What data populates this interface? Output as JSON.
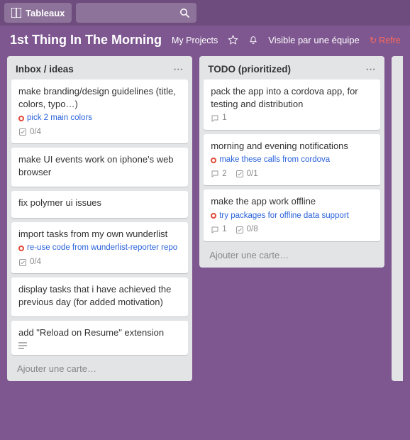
{
  "topbar": {
    "boards_label": "Tableaux"
  },
  "header": {
    "board_title": "1st Thing In The Morning",
    "my_projects": "My Projects",
    "visibility": "Visible par une équipe",
    "refresh": "Refre"
  },
  "lists": [
    {
      "title": "Inbox / ideas",
      "add_card": "Ajouter une carte…",
      "cards": [
        {
          "title": "make branding/design guidelines (title, colors, typo…)",
          "subtask": "pick 2 main colors",
          "checklist": "0/4"
        },
        {
          "title": "make UI events work on iphone's web browser"
        },
        {
          "title": "fix polymer ui issues"
        },
        {
          "title": "import tasks from my own wunderlist",
          "subtask": "re-use code from wunderlist-reporter repo",
          "checklist": "0/4"
        },
        {
          "title": "display tasks that i have achieved the previous day (for added motivation)"
        },
        {
          "title": "add \"Reload on Resume\" extension",
          "has_description": true
        }
      ]
    },
    {
      "title": "TODO (prioritized)",
      "add_card": "Ajouter une carte…",
      "cards": [
        {
          "title": "pack the app into a cordova app, for testing and distribution",
          "comments": "1"
        },
        {
          "title": "morning and evening notifications",
          "subtask": "make these calls from cordova",
          "comments": "2",
          "checklist": "0/1"
        },
        {
          "title": "make the app work offline",
          "subtask": "try packages for offline data support",
          "comments": "1",
          "checklist": "0/8"
        }
      ]
    }
  ]
}
